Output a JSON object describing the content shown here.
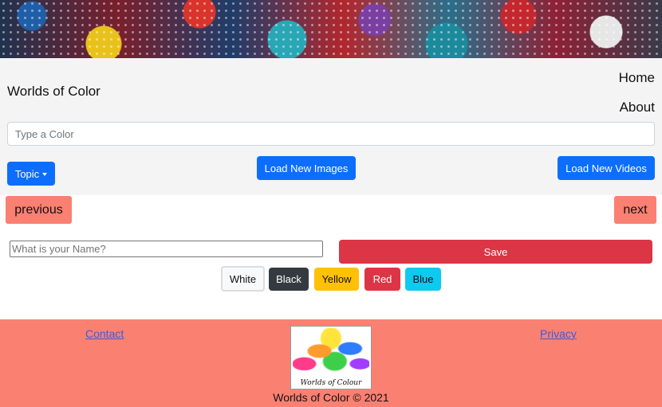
{
  "header": {
    "brand": "Worlds of Color",
    "nav": {
      "home": "Home",
      "about": "About"
    }
  },
  "search": {
    "placeholder": "Type a Color",
    "value": ""
  },
  "controls": {
    "topic_label": "Topic",
    "load_images_label": "Load New Images",
    "load_videos_label": "Load New Videos"
  },
  "pager": {
    "previous_label": "previous",
    "next_label": "next"
  },
  "name_form": {
    "placeholder": "What is your Name?",
    "value": "",
    "save_label": "Save"
  },
  "color_buttons": [
    {
      "label": "White",
      "color": "#f8f9fa"
    },
    {
      "label": "Black",
      "color": "#343a40"
    },
    {
      "label": "Yellow",
      "color": "#ffc107"
    },
    {
      "label": "Red",
      "color": "#dc3545"
    },
    {
      "label": "Blue",
      "color": "#0dcaf0"
    }
  ],
  "footer": {
    "contact_label": "Contact",
    "privacy_label": "Privacy",
    "logo_caption": "Worlds of Colour",
    "copyright": "Worlds of Color © 2021",
    "background": "#fa8072"
  },
  "colors": {
    "primary": "#0d6efd",
    "danger": "#dc3545",
    "salmon": "#fa8072"
  }
}
